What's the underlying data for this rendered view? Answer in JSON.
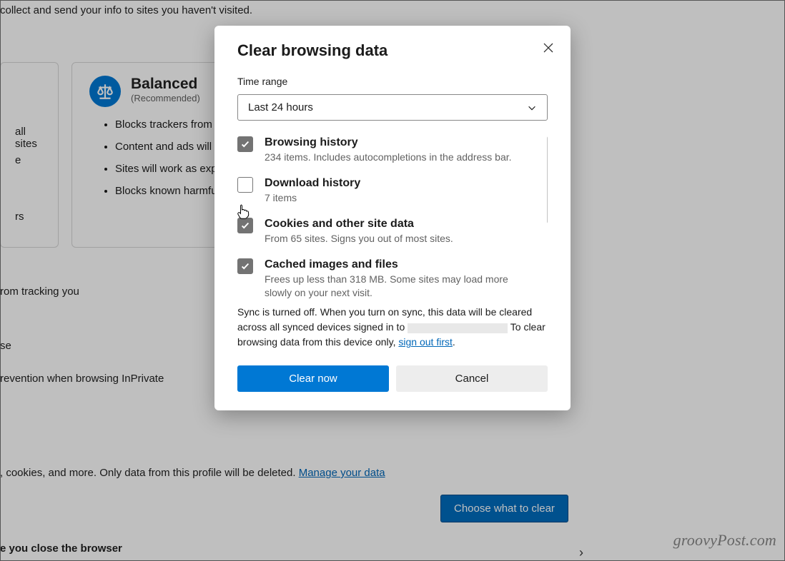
{
  "background": {
    "top_text": "collect and send your info to sites you haven't visited.",
    "basic_card": {
      "line1": "all sites",
      "line2": "e",
      "line3": "rs"
    },
    "balanced_card": {
      "title": "Balanced",
      "subtitle": "(Recommended)",
      "bullets": [
        "Blocks trackers from site haven't visited",
        "Content and ads will lik personalized",
        "Sites will work as expec",
        "Blocks known harmful t"
      ]
    },
    "tracking_line": "rom tracking you",
    "se_line": "se",
    "inprivate_line": "revention when browsing InPrivate",
    "cookies_line_prefix": ", cookies, and more. Only data from this profile will be deleted. ",
    "cookies_link": "Manage your data",
    "choose_button": "Choose what to clear",
    "close_browser_line": "e you close the browser",
    "watermark": "groovyPost.com"
  },
  "dialog": {
    "title": "Clear browsing data",
    "time_range_label": "Time range",
    "time_range_value": "Last 24 hours",
    "options": [
      {
        "checked": true,
        "title": "Browsing history",
        "desc": "234 items. Includes autocompletions in the address bar."
      },
      {
        "checked": false,
        "title": "Download history",
        "desc": "7 items"
      },
      {
        "checked": true,
        "title": "Cookies and other site data",
        "desc": "From 65 sites. Signs you out of most sites."
      },
      {
        "checked": true,
        "title": "Cached images and files",
        "desc": "Frees up less than 318 MB. Some sites may load more slowly on your next visit."
      }
    ],
    "sync_text_1": "Sync is turned off. When you turn on sync, this data will be cleared across all synced devices signed in to ",
    "sync_text_2": " To clear browsing data from this device only, ",
    "sync_link": "sign out first",
    "sync_period": ".",
    "clear_button": "Clear now",
    "cancel_button": "Cancel"
  }
}
